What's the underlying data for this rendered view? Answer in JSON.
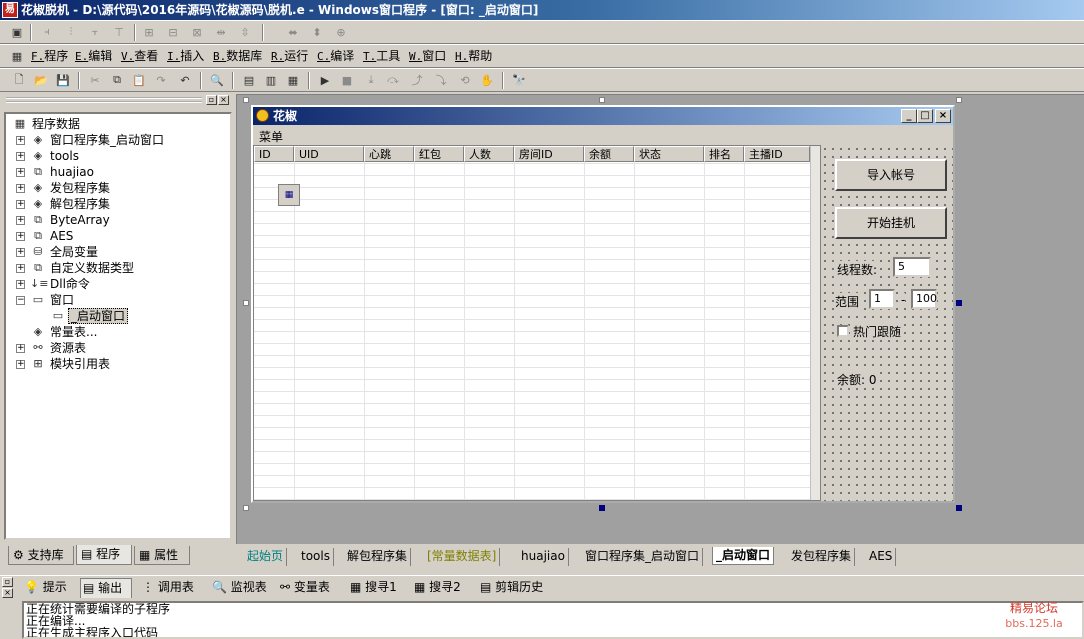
{
  "titlebar": {
    "title": "花椒脱机 - D:\\源代码\\2016年源码\\花椒源码\\脱机.e - Windows窗口程序 - [窗口: _启动窗口]"
  },
  "menubar": {
    "items": [
      {
        "key": "F.",
        "label": "程序"
      },
      {
        "key": "E.",
        "label": "编辑"
      },
      {
        "key": "V.",
        "label": "查看"
      },
      {
        "key": "I.",
        "label": "插入"
      },
      {
        "key": "B.",
        "label": "数据库"
      },
      {
        "key": "R.",
        "label": "运行"
      },
      {
        "key": "C.",
        "label": "编译"
      },
      {
        "key": "T.",
        "label": "工具"
      },
      {
        "key": "W.",
        "label": "窗口"
      },
      {
        "key": "H.",
        "label": "帮助"
      }
    ]
  },
  "tree": {
    "root": "程序数据",
    "items": [
      {
        "label": "窗口程序集_启动窗口",
        "expanded": false
      },
      {
        "label": "tools",
        "expanded": false
      },
      {
        "label": "huajiao",
        "expanded": false
      },
      {
        "label": "发包程序集",
        "expanded": false
      },
      {
        "label": "解包程序集",
        "expanded": false
      },
      {
        "label": "ByteArray",
        "expanded": false
      },
      {
        "label": "AES",
        "expanded": false
      },
      {
        "label": "全局变量",
        "expanded": false
      },
      {
        "label": "自定义数据类型",
        "expanded": false
      },
      {
        "label": "Dll命令",
        "expanded": false
      },
      {
        "label": "窗口",
        "expanded": true
      },
      {
        "label": "_启动窗口",
        "child": true,
        "selected": true
      },
      {
        "label": "常量表...",
        "expanded": null
      },
      {
        "label": "资源表",
        "expanded": false
      },
      {
        "label": "模块引用表",
        "expanded": false
      }
    ]
  },
  "left_tabs": [
    "支持库",
    "程序",
    "属性"
  ],
  "form": {
    "title": "花椒",
    "menu": "菜单",
    "columns": [
      "ID",
      "UID",
      "心跳",
      "红包",
      "人数",
      "房间ID",
      "余额",
      "状态",
      "排名",
      "主播ID"
    ],
    "buttons": {
      "import": "导入帐号",
      "start": "开始挂机"
    },
    "thread_label": "线程数:",
    "thread_value": "5",
    "range_label": "范围",
    "range_from": "1",
    "range_dash": "-",
    "range_to": "100",
    "follow_label": "热门跟随",
    "balance_label": "余额: 0"
  },
  "bottom_tabs": [
    "起始页",
    "tools",
    "解包程序集",
    "[常量数据表]",
    "huajiao",
    "窗口程序集_启动窗口",
    "_启动窗口",
    "发包程序集",
    "AES"
  ],
  "output_tabs": [
    "提示",
    "输出",
    "调用表",
    "监视表",
    "变量表",
    "搜寻1",
    "搜寻2",
    "剪辑历史"
  ],
  "output_lines": [
    "正在统计需要编译的子程序",
    "正在编译...",
    "正在生成主程序入口代码"
  ],
  "watermark": {
    "line1": "精易论坛",
    "line2": "bbs.125.la"
  },
  "colors": {
    "title_start": "#0a246a",
    "title_end": "#a6caf0",
    "face": "#d4d0c8",
    "workspace": "#a0a0a0",
    "watermark": "#d23a2a"
  }
}
